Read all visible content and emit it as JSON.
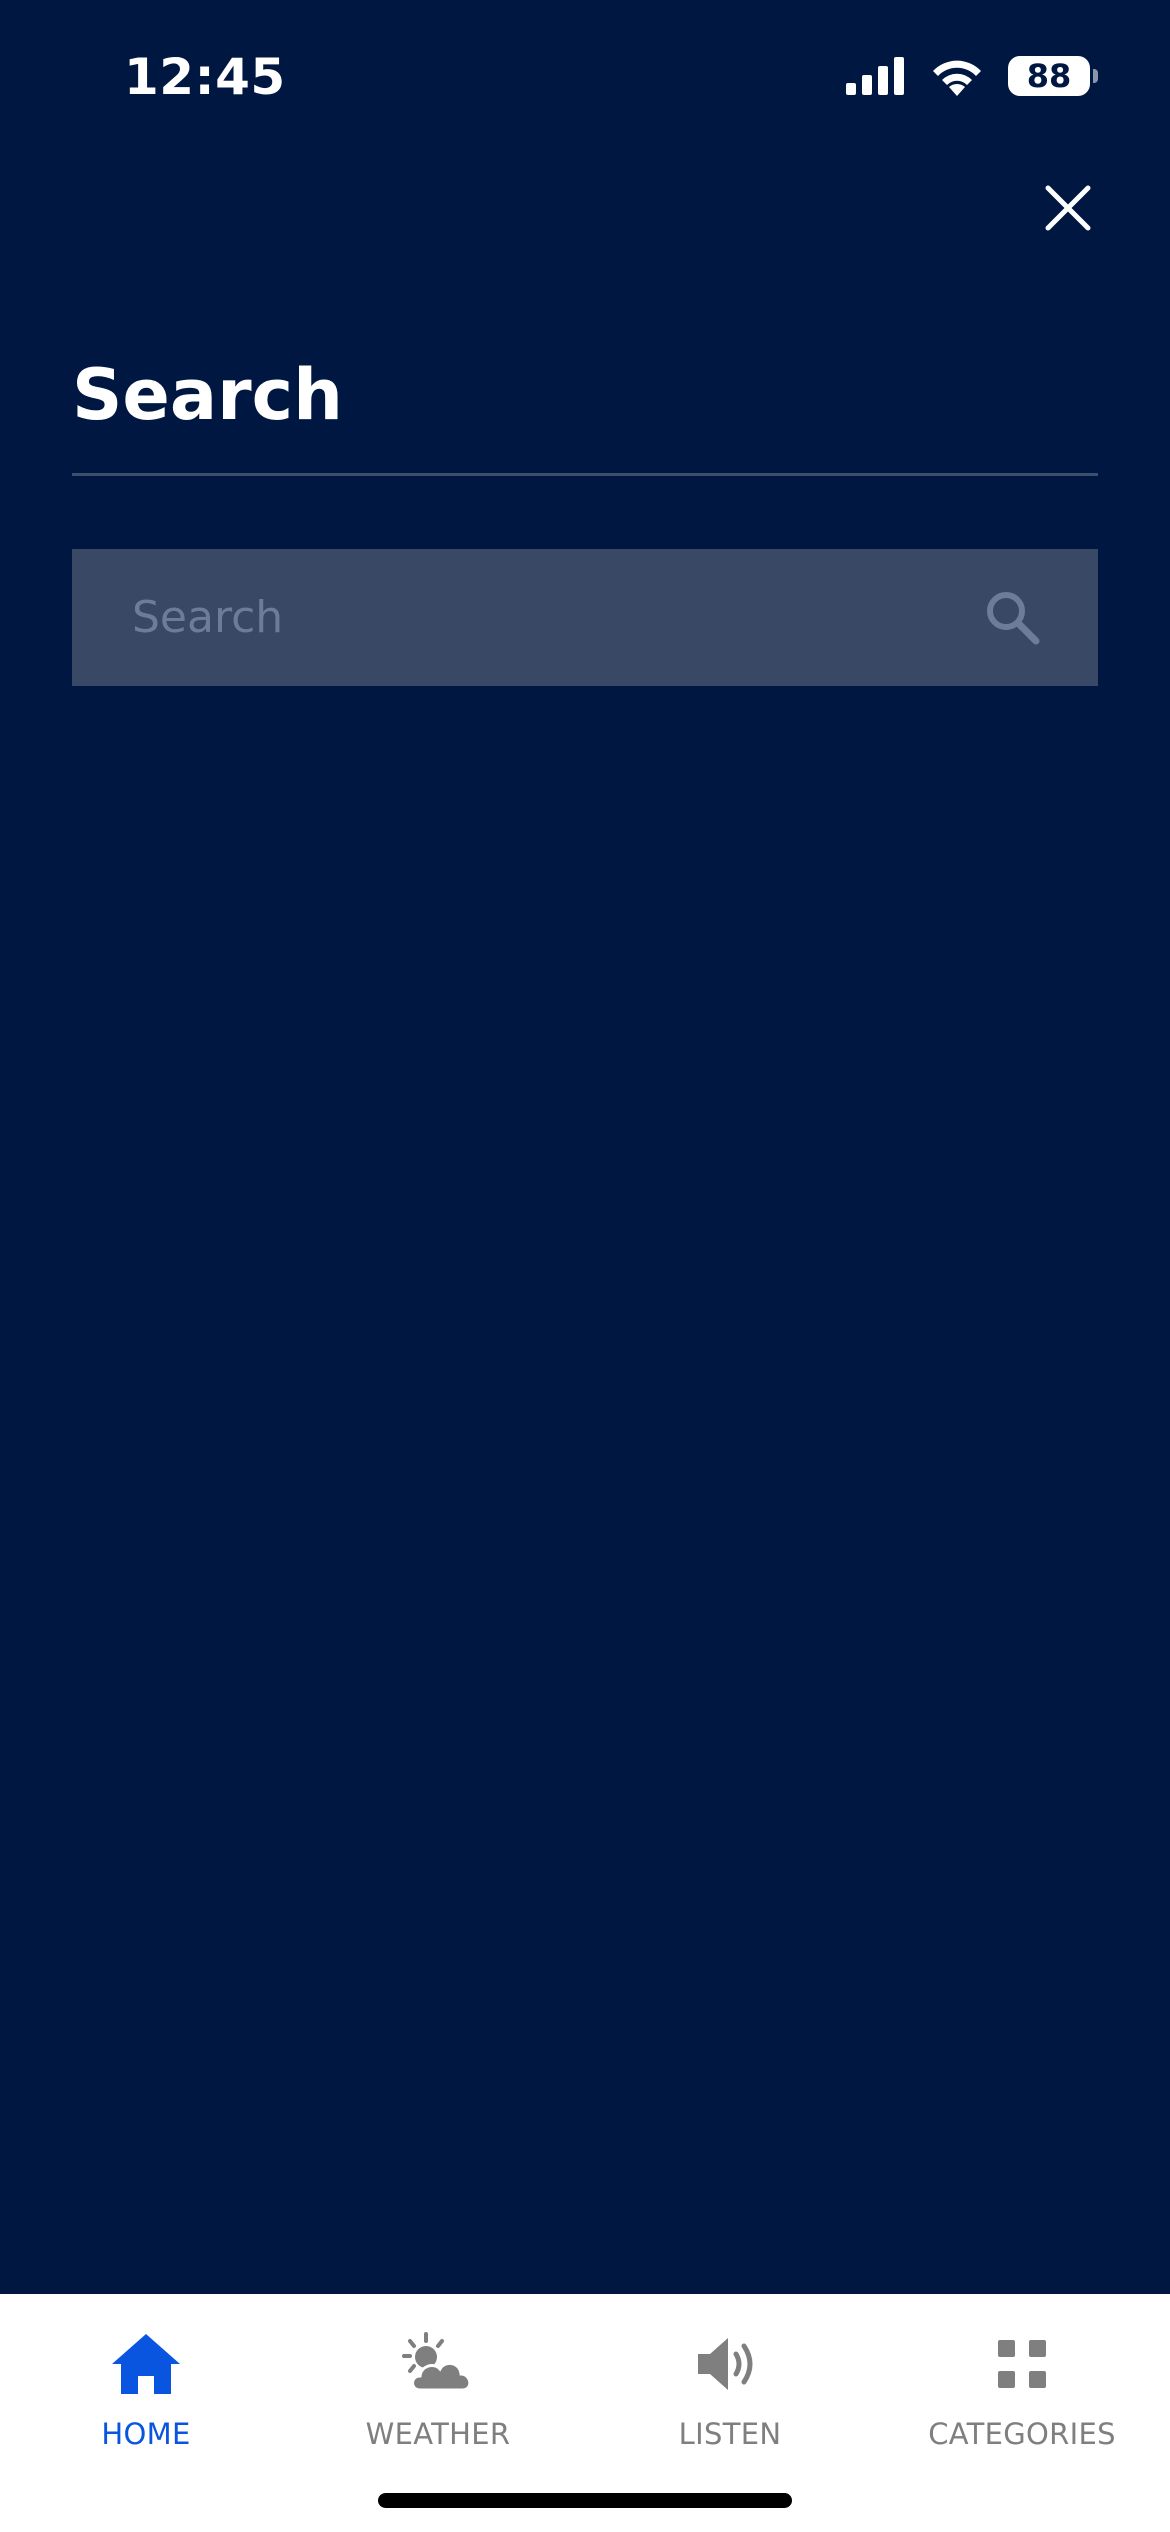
{
  "status_bar": {
    "time": "12:45",
    "battery_level": "88"
  },
  "page": {
    "title": "Search"
  },
  "search": {
    "placeholder": "Search",
    "value": ""
  },
  "tabs": [
    {
      "label": "HOME",
      "icon": "home-icon",
      "active": true
    },
    {
      "label": "WEATHER",
      "icon": "weather-icon",
      "active": false
    },
    {
      "label": "LISTEN",
      "icon": "speaker-icon",
      "active": false
    },
    {
      "label": "CATEGORIES",
      "icon": "grid-icon",
      "active": false
    }
  ],
  "colors": {
    "background": "#001742",
    "search_field": "#394865",
    "divider": "#3d4e6e",
    "tab_active": "#0a55e0",
    "tab_inactive": "#7f7f7f",
    "tab_bar": "#ffffff"
  }
}
